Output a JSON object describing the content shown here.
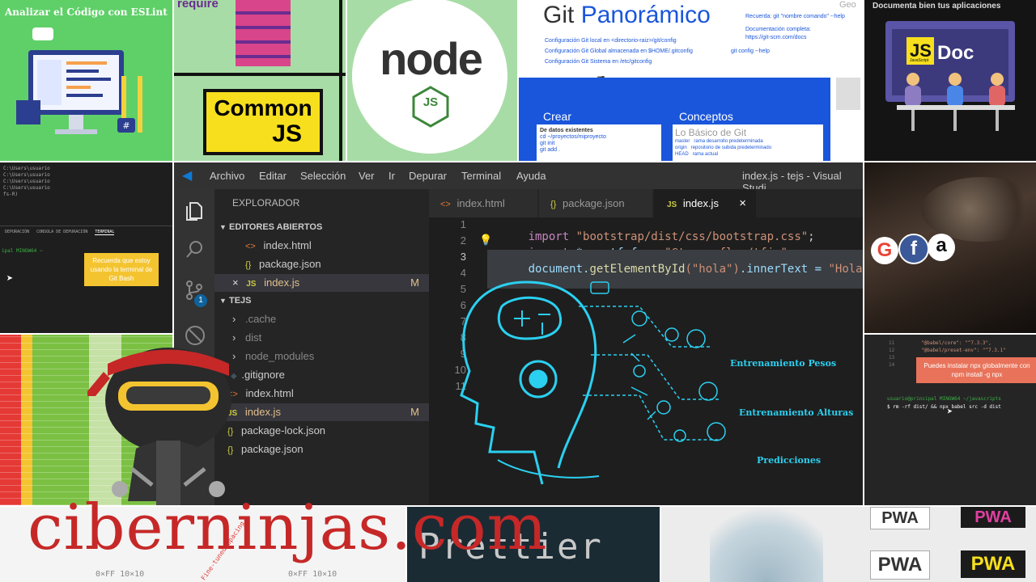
{
  "tiles": {
    "eslint": {
      "title": "Analizar el Código con ESLint"
    },
    "commonjs": {
      "require": "require",
      "line1": "Common",
      "line2": "JS"
    },
    "node": {
      "word": "node",
      "sub": "JS"
    },
    "git": {
      "title_a": "Git",
      "title_b": "Panorámico",
      "right_lines": [
        "Recuerda: git \"nombre comando\" --help",
        "Documentación completa:",
        "https://git-scm.com/docs"
      ],
      "config_lines": [
        "Configuración Git local en <directorio-raiz>/git/config",
        "Configuración Git Global almacenada en $HOME/.gitconfig",
        "Configuración Git Sistema en /etc/gitconfig"
      ],
      "config_help": "git config --help",
      "crear": "Crear",
      "conceptos": "Conceptos",
      "existentes": "De datos existentes",
      "crear_cmds": [
        "cd ~/proyectos/miproyecto",
        "git init",
        "git add ."
      ],
      "basico": "Lo Básico de Git",
      "conceptos_rows": [
        [
          "master",
          "rama desarrollo predeterminada"
        ],
        [
          "origin",
          "repositorio de subida predeterminado"
        ],
        [
          "HEAD",
          "rama actual"
        ]
      ],
      "corner": "Geo"
    },
    "jsdoc": {
      "caption": "Documenta bien tus aplicaciones",
      "js": "JS",
      "doc": "Doc",
      "js_sub": "JavaScript"
    },
    "terminal1": {
      "lines": [
        "C:\\Users\\usuario",
        "C:\\Users\\usuario",
        "C:\\Users\\usuario",
        "C:\\Users\\usuario",
        "fs-R)"
      ],
      "panel_tabs": [
        "DEPURACIÓN",
        "CONSOLA DE DEPURACIÓN",
        "TERMINAL"
      ],
      "prompt": "ipal MINGW64 ~",
      "note": "Recuerda que estoy usando la terminal de Git Bash"
    },
    "eye": {
      "icons": [
        "G",
        "f",
        "a"
      ]
    },
    "terminal2": {
      "code_lines": [
        "\"@babel/core\": \"^7.3.3\",",
        "\"@babel/preset-env\": \"^7.3.1\""
      ],
      "line_numbers": [
        "11",
        "12",
        "13",
        "14"
      ],
      "note": "Puedes instalar npx globalmente con npm install -g npx",
      "prompt": "usuario@principal MINGW64 ~/javascripts",
      "command": "$ rm -rf dist/ && npx babel src -d dist"
    },
    "fonttile": {
      "bits": [
        "0×FF 10×10",
        "Fine-tuned Spacing",
        "0×FF 10×10"
      ]
    },
    "prettier": {
      "word": "Prettier"
    },
    "pwa": {
      "label": "PWA"
    }
  },
  "vscode": {
    "menu": [
      "Archivo",
      "Editar",
      "Selección",
      "Ver",
      "Ir",
      "Depurar",
      "Terminal",
      "Ayuda"
    ],
    "title": "index.js - tejs - Visual Studi",
    "badge": "1",
    "explorer": {
      "header": "EXPLORADOR",
      "open_editors_header": "EDITORES ABIERTOS",
      "open_editors": [
        {
          "icon": "<>",
          "name": "index.html"
        },
        {
          "icon": "{}",
          "name": "package.json"
        },
        {
          "icon": "JS",
          "name": "index.js",
          "status": "M",
          "close": "×"
        }
      ],
      "project_header": "TEJS",
      "items": [
        {
          "icon": "›",
          "name": ".cache"
        },
        {
          "icon": "›",
          "name": "dist"
        },
        {
          "icon": "›",
          "name": "node_modules"
        },
        {
          "icon": "◆",
          "name": ".gitignore"
        },
        {
          "icon": "<>",
          "name": "index.html"
        },
        {
          "icon": "JS",
          "name": "index.js",
          "status": "M"
        },
        {
          "icon": "{}",
          "name": "package-lock.json"
        },
        {
          "icon": "{}",
          "name": "package.json"
        }
      ]
    },
    "tabs": [
      {
        "icon": "<>",
        "name": "index.html"
      },
      {
        "icon": "{}",
        "name": "package.json"
      },
      {
        "icon": "JS",
        "name": "index.js",
        "close": "×"
      }
    ],
    "line_numbers": [
      "1",
      "2",
      "3",
      "4",
      "5",
      "6",
      "7",
      "8",
      "9",
      "10",
      "11"
    ],
    "code": [
      {
        "kw": "import",
        "rest": " ",
        "str": "\"bootstrap/dist/css/bootstrap.css\"",
        "end": ";"
      },
      {
        "kw": "import",
        "rest": " * as tf from ",
        "str": "\"@tensorflow/tfjs\"",
        "end": ";"
      },
      {
        "plain": "document.",
        "fn": "getElementById",
        "arg": "(\"hola\")",
        "prop": ".innerText = ",
        "str": "\"Hola\"",
        "end": ";"
      }
    ],
    "ai_labels": [
      "Entrenamiento Pesos",
      "Entrenamiento Alturas",
      "Predicciones"
    ]
  },
  "brand": {
    "name": "ciberninjas.com"
  },
  "colors": {
    "brand": "#c62828",
    "eslint_bg": "#5fd068",
    "git_blue": "#1a56db",
    "vscode_bg": "#1e1e1e",
    "ai_cyan": "#2bd0f0",
    "jsdoc_bg": "#141414"
  }
}
